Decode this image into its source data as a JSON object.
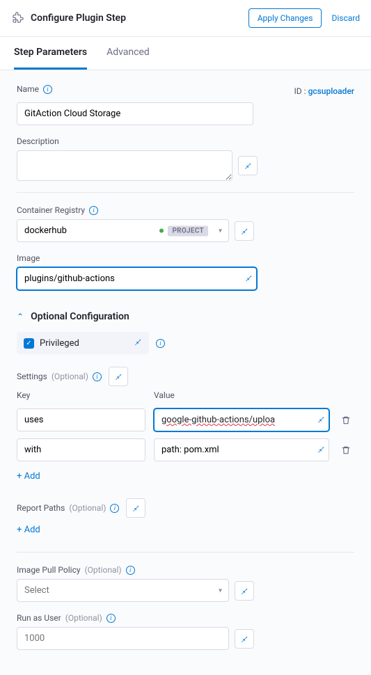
{
  "header": {
    "title": "Configure Plugin Step",
    "apply": "Apply Changes",
    "discard": "Discard"
  },
  "tabs": {
    "params": "Step Parameters",
    "advanced": "Advanced"
  },
  "name": {
    "label": "Name",
    "value": "GitAction Cloud Storage"
  },
  "id": {
    "label": "ID :",
    "value": "gcsuploader"
  },
  "description": {
    "label": "Description",
    "value": ""
  },
  "registry": {
    "label": "Container Registry",
    "value": "dockerhub",
    "scope": "PROJECT"
  },
  "image": {
    "label": "Image",
    "value": "plugins/github-actions"
  },
  "optional": {
    "title": "Optional Configuration"
  },
  "privileged": {
    "label": "Privileged"
  },
  "settings": {
    "label": "Settings",
    "optional": "(Optional)",
    "key_label": "Key",
    "value_label": "Value",
    "rows": [
      {
        "key": "uses",
        "value": "google-github-actions/uploa"
      },
      {
        "key": "with",
        "value": "path: pom.xml"
      }
    ],
    "add": "+ Add"
  },
  "report": {
    "label": "Report Paths",
    "optional": "(Optional)",
    "add": "+ Add"
  },
  "pull": {
    "label": "Image Pull Policy",
    "optional": "(Optional)",
    "placeholder": "Select"
  },
  "runas": {
    "label": "Run as User",
    "optional": "(Optional)",
    "placeholder": "1000"
  }
}
